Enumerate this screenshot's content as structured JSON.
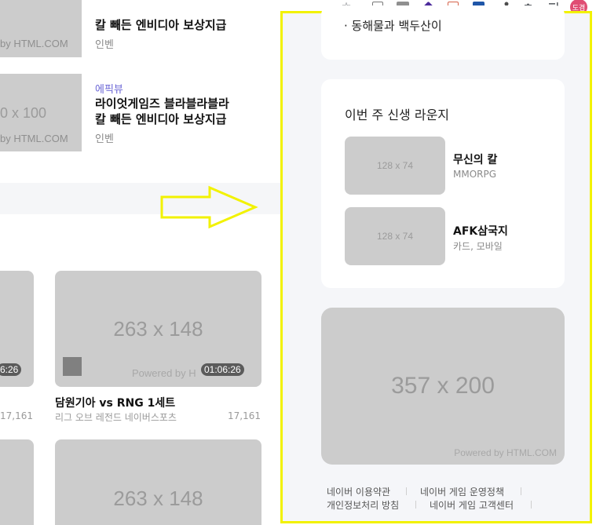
{
  "browser": {
    "url_fragment": "l#",
    "profile_label": "도겸",
    "icons": [
      "star-icon",
      "tab-icon",
      "extension-ex-icon",
      "extension-purple-icon",
      "extension-doc-icon",
      "extension-li-icon",
      "eyedropper-icon",
      "puzzle-extensions-icon",
      "playlist-icon"
    ]
  },
  "left": {
    "news": [
      {
        "category": "",
        "title_line1": "칼 빼든 엔비디아 보상지급",
        "title_line2": "",
        "source": "인벤",
        "thumb": "by HTML.COM"
      },
      {
        "category": "에픽뷰",
        "title_line1": "라이엇게임즈 블라블라블라",
        "title_line2": "칼 빼든 엔비디아 보상지급",
        "source": "인벤",
        "thumb_size": "0 x 100",
        "thumb": "by HTML.COM"
      }
    ],
    "videos": [
      {
        "size": "",
        "duration": "6:26",
        "title": "",
        "league": "",
        "views": "17,161"
      },
      {
        "size": "263 x 148",
        "powered": "Powered by H",
        "duration": "01:06:26",
        "title": "담원기아 vs RNG 1세트",
        "league": "리그 오브 레전드 네이버스포츠",
        "views": "17,161"
      },
      {
        "size": "263 x 148"
      }
    ]
  },
  "right": {
    "top_card": {
      "bullet": "· 동해물과 백두산이"
    },
    "lounge": {
      "title": "이번 주 신생 라운지",
      "games": [
        {
          "thumb": "128 x 74",
          "name": "무신의 칼",
          "genre": "MMORPG"
        },
        {
          "thumb": "128 x 74",
          "name": "AFK삼국지",
          "genre": "카드, 모바일"
        }
      ]
    },
    "ad": {
      "size": "357 x 200",
      "powered": "Powered by HTML.COM"
    },
    "footer": {
      "links": [
        "네이버 이용약관",
        "네이버 게임 운영정책",
        "개인정보처리 방침",
        "네이버 게임 고객센터"
      ]
    }
  },
  "colors": {
    "highlight": "#f2f200",
    "category": "#6b66d6",
    "placeholder": "#cccccc",
    "profile": "#e04d73"
  }
}
